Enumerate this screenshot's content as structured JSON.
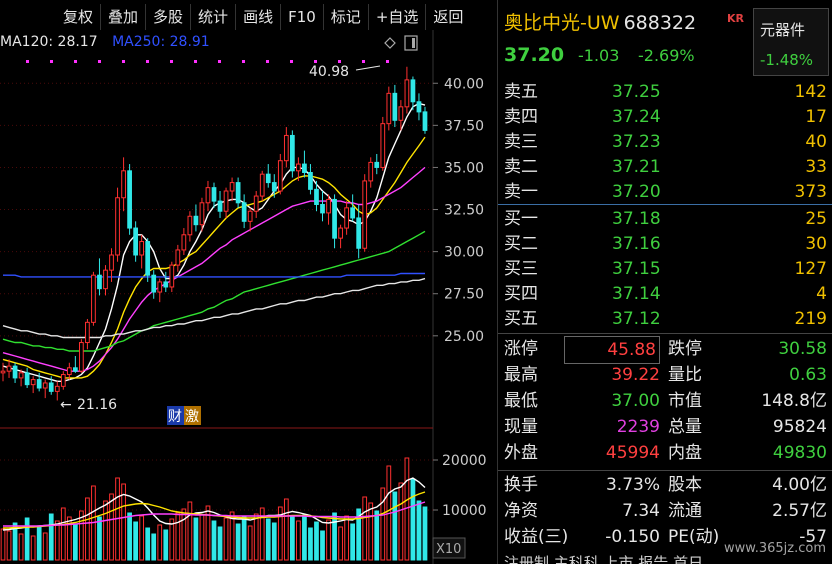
{
  "toolbar": {
    "items": [
      "复权",
      "叠加",
      "多股",
      "统计",
      "画线",
      "F10",
      "标记",
      "+自选",
      "返回"
    ]
  },
  "ma_legend": {
    "ma120": "MA120: 28.17",
    "ma250": "MA250: 28.91",
    "ma120_color": "#e6e6e6",
    "ma250_color": "#3050ff"
  },
  "chart_data": {
    "type": "candlestick",
    "y_ticks": [
      "40.00",
      "37.50",
      "35.00",
      "32.50",
      "30.00",
      "27.50",
      "25.00"
    ],
    "y_tick_values": [
      40.0,
      37.5,
      35.0,
      32.5,
      30.0,
      27.5,
      25.0
    ],
    "ylim": [
      20.0,
      41.5
    ],
    "high_annotation": "40.98",
    "low_annotation": "21.16",
    "volume_ticks": [
      "20000",
      "10000"
    ],
    "volume_tick_values": [
      20000,
      10000
    ],
    "volume_ylim": [
      0,
      24000
    ],
    "volume_unit": "X10",
    "badge_1": "财",
    "badge_2": "激",
    "candles": [
      [
        22.8,
        23.4,
        22.3,
        22.9
      ],
      [
        22.9,
        23.6,
        22.5,
        23.2
      ],
      [
        23.2,
        23.4,
        22.2,
        22.5
      ],
      [
        22.5,
        23.0,
        22.0,
        22.8
      ],
      [
        22.8,
        23.1,
        21.9,
        22.1
      ],
      [
        22.1,
        22.6,
        21.6,
        22.4
      ],
      [
        22.4,
        22.8,
        21.7,
        21.9
      ],
      [
        21.9,
        22.4,
        21.3,
        22.2
      ],
      [
        22.2,
        22.6,
        21.5,
        21.7
      ],
      [
        21.7,
        22.3,
        21.16,
        22.0
      ],
      [
        22.0,
        22.9,
        21.8,
        22.7
      ],
      [
        22.7,
        23.4,
        22.4,
        23.1
      ],
      [
        23.1,
        23.8,
        22.8,
        22.9
      ],
      [
        22.9,
        24.8,
        22.8,
        24.6
      ],
      [
        24.6,
        26.0,
        24.2,
        25.8
      ],
      [
        25.8,
        28.8,
        25.6,
        28.6
      ],
      [
        28.6,
        29.6,
        27.4,
        27.8
      ],
      [
        27.8,
        29.2,
        27.4,
        28.9
      ],
      [
        28.9,
        30.2,
        28.2,
        29.8
      ],
      [
        29.8,
        33.8,
        29.4,
        33.2
      ],
      [
        33.2,
        35.6,
        32.4,
        34.8
      ],
      [
        34.8,
        35.2,
        31.0,
        31.4
      ],
      [
        31.4,
        31.8,
        29.4,
        29.8
      ],
      [
        29.8,
        31.0,
        29.0,
        30.6
      ],
      [
        30.6,
        30.8,
        28.2,
        28.6
      ],
      [
        28.6,
        28.9,
        27.2,
        27.6
      ],
      [
        27.6,
        28.4,
        27.0,
        28.2
      ],
      [
        28.2,
        28.8,
        27.6,
        27.9
      ],
      [
        27.9,
        29.4,
        27.6,
        29.2
      ],
      [
        29.2,
        30.4,
        28.8,
        30.1
      ],
      [
        30.1,
        31.4,
        29.8,
        31.0
      ],
      [
        31.0,
        32.4,
        30.6,
        32.1
      ],
      [
        32.1,
        32.8,
        31.2,
        31.6
      ],
      [
        31.6,
        33.2,
        31.2,
        32.9
      ],
      [
        32.9,
        34.2,
        32.4,
        33.8
      ],
      [
        33.8,
        34.1,
        32.6,
        33.0
      ],
      [
        33.0,
        33.6,
        32.0,
        32.4
      ],
      [
        32.4,
        33.8,
        32.0,
        33.6
      ],
      [
        33.6,
        34.4,
        33.0,
        34.1
      ],
      [
        34.1,
        34.4,
        32.6,
        32.9
      ],
      [
        32.9,
        33.4,
        31.4,
        31.8
      ],
      [
        31.8,
        32.6,
        31.2,
        32.4
      ],
      [
        32.4,
        33.6,
        32.0,
        33.3
      ],
      [
        33.3,
        34.8,
        33.0,
        34.6
      ],
      [
        34.6,
        35.2,
        33.8,
        34.1
      ],
      [
        34.1,
        34.6,
        33.2,
        33.6
      ],
      [
        33.6,
        35.8,
        33.4,
        35.4
      ],
      [
        35.4,
        37.4,
        35.0,
        36.9
      ],
      [
        36.9,
        37.2,
        34.4,
        34.8
      ],
      [
        34.8,
        35.6,
        34.2,
        35.2
      ],
      [
        35.2,
        36.0,
        34.4,
        34.7
      ],
      [
        34.7,
        35.2,
        33.4,
        33.7
      ],
      [
        33.7,
        34.2,
        32.4,
        32.8
      ],
      [
        32.8,
        33.6,
        31.8,
        32.3
      ],
      [
        32.3,
        33.4,
        31.6,
        33.1
      ],
      [
        33.1,
        33.4,
        30.2,
        30.8
      ],
      [
        30.8,
        31.6,
        30.2,
        31.4
      ],
      [
        31.4,
        33.0,
        31.0,
        32.6
      ],
      [
        32.6,
        33.4,
        31.8,
        32.0
      ],
      [
        32.0,
        32.8,
        29.6,
        30.2
      ],
      [
        30.2,
        34.6,
        30.0,
        34.2
      ],
      [
        34.2,
        35.6,
        33.8,
        35.3
      ],
      [
        35.3,
        35.8,
        34.6,
        35.0
      ],
      [
        35.0,
        38.0,
        34.8,
        37.6
      ],
      [
        37.6,
        39.8,
        37.2,
        39.4
      ],
      [
        39.4,
        39.9,
        37.4,
        37.8
      ],
      [
        37.8,
        39.0,
        37.2,
        38.6
      ],
      [
        38.6,
        40.98,
        38.2,
        40.2
      ],
      [
        40.2,
        40.4,
        38.4,
        38.9
      ],
      [
        38.9,
        39.4,
        37.8,
        38.3
      ],
      [
        38.3,
        38.6,
        37.0,
        37.2
      ]
    ],
    "ma_lines": [
      {
        "color": "#ffffff",
        "values": [
          23.2,
          23.1,
          23.0,
          22.9,
          22.8,
          22.7,
          22.6,
          22.5,
          22.4,
          22.3,
          22.3,
          22.4,
          22.5,
          22.7,
          23.1,
          23.8,
          24.6,
          25.4,
          26.6,
          28.0,
          29.8,
          30.6,
          31.0,
          31.0,
          30.6,
          30.0,
          29.0,
          28.4,
          28.4,
          28.6,
          29.2,
          30.0,
          30.6,
          31.3,
          32.2,
          32.7,
          32.9,
          33.0,
          33.1,
          33.1,
          32.9,
          32.6,
          32.4,
          32.6,
          33.1,
          33.6,
          34.0,
          34.6,
          35.0,
          35.0,
          34.9,
          34.5,
          34.0,
          33.6,
          33.3,
          32.8,
          32.2,
          31.9,
          31.8,
          31.6,
          31.8,
          32.4,
          33.2,
          34.4,
          35.6,
          36.4,
          37.2,
          38.0,
          38.6,
          38.8,
          38.7
        ]
      },
      {
        "color": "#ffe400",
        "values": [
          23.6,
          23.5,
          23.4,
          23.3,
          23.2,
          23.0,
          22.9,
          22.8,
          22.7,
          22.6,
          22.5,
          22.5,
          22.5,
          22.5,
          22.6,
          22.9,
          23.3,
          23.9,
          24.6,
          25.4,
          26.4,
          27.2,
          27.9,
          28.4,
          28.8,
          29.0,
          29.0,
          29.0,
          29.1,
          29.3,
          29.5,
          29.8,
          30.0,
          30.4,
          30.8,
          31.2,
          31.6,
          32.0,
          32.3,
          32.6,
          32.7,
          32.8,
          32.9,
          33.0,
          33.2,
          33.4,
          33.6,
          33.9,
          34.2,
          34.4,
          34.5,
          34.5,
          34.4,
          34.3,
          34.1,
          33.8,
          33.4,
          33.1,
          32.8,
          32.4,
          32.2,
          32.3,
          32.6,
          33.1,
          33.6,
          34.1,
          34.7,
          35.3,
          35.8,
          36.3,
          36.8
        ]
      },
      {
        "color": "#ff40ff",
        "values": [
          24.0,
          23.9,
          23.8,
          23.7,
          23.6,
          23.5,
          23.4,
          23.3,
          23.2,
          23.1,
          23.0,
          22.9,
          22.9,
          22.9,
          23.0,
          23.2,
          23.5,
          23.9,
          24.3,
          24.8,
          25.4,
          26.0,
          26.5,
          27.0,
          27.4,
          27.7,
          27.9,
          28.1,
          28.3,
          28.5,
          28.7,
          28.9,
          29.1,
          29.3,
          29.6,
          29.9,
          30.2,
          30.4,
          30.7,
          30.9,
          31.1,
          31.3,
          31.5,
          31.7,
          31.9,
          32.1,
          32.3,
          32.5,
          32.7,
          32.8,
          32.9,
          33.0,
          33.0,
          33.0,
          33.0,
          33.0,
          33.0,
          32.9,
          32.9,
          32.8,
          32.8,
          32.9,
          33.0,
          33.2,
          33.4,
          33.6,
          33.8,
          34.1,
          34.4,
          34.7,
          35.0
        ]
      },
      {
        "color": "#30e030",
        "values": [
          24.8,
          24.7,
          24.6,
          24.6,
          24.5,
          24.4,
          24.4,
          24.3,
          24.3,
          24.2,
          24.2,
          24.1,
          24.1,
          24.1,
          24.1,
          24.1,
          24.2,
          24.3,
          24.4,
          24.6,
          24.7,
          24.9,
          25.1,
          25.3,
          25.4,
          25.6,
          25.7,
          25.8,
          25.9,
          26.0,
          26.1,
          26.2,
          26.3,
          26.4,
          26.6,
          26.7,
          26.9,
          27.1,
          27.2,
          27.4,
          27.6,
          27.7,
          27.8,
          27.9,
          28.0,
          28.1,
          28.2,
          28.3,
          28.4,
          28.5,
          28.6,
          28.7,
          28.8,
          28.9,
          29.0,
          29.1,
          29.2,
          29.3,
          29.4,
          29.5,
          29.6,
          29.7,
          29.8,
          29.9,
          30.0,
          30.2,
          30.4,
          30.6,
          30.8,
          31.0,
          31.2
        ]
      },
      {
        "color": "#e6e6e6",
        "values": [
          25.6,
          25.5,
          25.4,
          25.3,
          25.3,
          25.2,
          25.1,
          25.1,
          25.0,
          25.0,
          24.9,
          24.9,
          24.9,
          24.9,
          24.9,
          24.9,
          24.9,
          25.0,
          25.0,
          25.1,
          25.1,
          25.2,
          25.3,
          25.3,
          25.4,
          25.5,
          25.5,
          25.6,
          25.6,
          25.7,
          25.7,
          25.8,
          25.9,
          25.9,
          26.0,
          26.1,
          26.1,
          26.2,
          26.3,
          26.3,
          26.4,
          26.5,
          26.6,
          26.6,
          26.7,
          26.8,
          26.9,
          26.9,
          27.0,
          27.1,
          27.1,
          27.2,
          27.3,
          27.3,
          27.4,
          27.5,
          27.5,
          27.6,
          27.7,
          27.7,
          27.8,
          27.9,
          28.0,
          28.0,
          28.1,
          28.1,
          28.2,
          28.2,
          28.3,
          28.3,
          28.4
        ]
      },
      {
        "color": "#3050ff",
        "values": [
          28.6,
          28.6,
          28.6,
          28.5,
          28.5,
          28.5,
          28.5,
          28.5,
          28.5,
          28.5,
          28.5,
          28.5,
          28.5,
          28.5,
          28.5,
          28.5,
          28.5,
          28.5,
          28.5,
          28.5,
          28.5,
          28.5,
          28.5,
          28.5,
          28.5,
          28.5,
          28.5,
          28.5,
          28.5,
          28.5,
          28.5,
          28.5,
          28.5,
          28.5,
          28.5,
          28.5,
          28.5,
          28.5,
          28.5,
          28.5,
          28.5,
          28.5,
          28.5,
          28.5,
          28.5,
          28.5,
          28.5,
          28.5,
          28.5,
          28.5,
          28.5,
          28.5,
          28.5,
          28.5,
          28.5,
          28.5,
          28.5,
          28.6,
          28.6,
          28.6,
          28.6,
          28.6,
          28.6,
          28.6,
          28.6,
          28.6,
          28.7,
          28.7,
          28.7,
          28.7,
          28.7
        ]
      }
    ],
    "volumes": [
      6200,
      5800,
      7400,
      5200,
      8400,
      4800,
      6600,
      5400,
      9200,
      7800,
      10400,
      8600,
      7200,
      9800,
      12400,
      14800,
      8600,
      11800,
      13200,
      16400,
      15200,
      9400,
      7600,
      8800,
      6400,
      5200,
      7000,
      6000,
      8200,
      9400,
      10200,
      11600,
      8400,
      9000,
      10800,
      7800,
      6600,
      8400,
      9600,
      7200,
      8800,
      6800,
      9200,
      10400,
      8200,
      7400,
      10600,
      12200,
      8600,
      7800,
      9000,
      6400,
      7600,
      5800,
      8000,
      9400,
      6600,
      8800,
      7200,
      10200,
      12600,
      11400,
      9800,
      14400,
      18800,
      13600,
      15400,
      20400,
      16200,
      11800,
      10600
    ],
    "vol_ma": [
      {
        "color": "#ffffff",
        "values": [
          6000,
          6100,
          6300,
          6400,
          6600,
          6700,
          6800,
          6900,
          7000,
          7200,
          7500,
          7800,
          8100,
          8500,
          9000,
          9700,
          10400,
          11000,
          11800,
          12600,
          13100,
          12800,
          12200,
          11600,
          10400,
          9000,
          7800,
          7300,
          7200,
          7500,
          8100,
          9000,
          9400,
          9500,
          9800,
          9500,
          9000,
          8600,
          8300,
          8200,
          8200,
          8000,
          8300,
          8600,
          8900,
          8900,
          9000,
          9400,
          9700,
          9500,
          9200,
          8900,
          8200,
          7500,
          7400,
          7600,
          7800,
          8100,
          8000,
          8700,
          9600,
          10200,
          10600,
          11600,
          13400,
          14200,
          14600,
          15900,
          16400,
          15600,
          14500
        ]
      },
      {
        "color": "#ffe400",
        "values": [
          6400,
          6400,
          6500,
          6500,
          6600,
          6600,
          6700,
          6800,
          6900,
          7000,
          7100,
          7300,
          7500,
          7800,
          8100,
          8500,
          8900,
          9300,
          9800,
          10300,
          10800,
          11000,
          11200,
          11300,
          11200,
          10900,
          10600,
          10200,
          9800,
          9600,
          9400,
          9300,
          9200,
          9100,
          9000,
          8900,
          8800,
          8700,
          8600,
          8500,
          8400,
          8400,
          8400,
          8500,
          8600,
          8600,
          8700,
          8800,
          8900,
          8900,
          8900,
          8800,
          8700,
          8500,
          8400,
          8300,
          8200,
          8200,
          8200,
          8300,
          8500,
          8700,
          8900,
          9300,
          9900,
          10600,
          11200,
          12000,
          12700,
          13200,
          13600
        ]
      },
      {
        "color": "#ff40ff",
        "values": [
          6800,
          6800,
          6800,
          6800,
          6800,
          6800,
          6800,
          6900,
          6900,
          7000,
          7000,
          7100,
          7200,
          7300,
          7400,
          7500,
          7700,
          7900,
          8100,
          8300,
          8500,
          8700,
          8900,
          9000,
          9100,
          9200,
          9200,
          9200,
          9200,
          9100,
          9100,
          9100,
          9000,
          9000,
          9000,
          8900,
          8900,
          8900,
          8800,
          8800,
          8800,
          8800,
          8800,
          8800,
          8800,
          8800,
          8800,
          8800,
          8800,
          8800,
          8800,
          8700,
          8700,
          8700,
          8700,
          8700,
          8600,
          8600,
          8600,
          8600,
          8700,
          8800,
          8900,
          9000,
          9300,
          9600,
          10000,
          10400,
          10800,
          11200,
          11600
        ]
      }
    ]
  },
  "quote": {
    "name": "奥比中光-UW",
    "code": "688322",
    "kr_badge": "KR",
    "price": "37.20",
    "change": "-1.03",
    "change_pct": "-2.69%",
    "sector_name": "元器件",
    "sector_pct": "-1.48%"
  },
  "order_book": {
    "asks": [
      {
        "label": "卖五",
        "price": "37.25",
        "vol": "142"
      },
      {
        "label": "卖四",
        "price": "37.24",
        "vol": "17"
      },
      {
        "label": "卖三",
        "price": "37.23",
        "vol": "40"
      },
      {
        "label": "卖二",
        "price": "37.21",
        "vol": "33"
      },
      {
        "label": "卖一",
        "price": "37.20",
        "vol": "373"
      }
    ],
    "bids": [
      {
        "label": "买一",
        "price": "37.18",
        "vol": "25"
      },
      {
        "label": "买二",
        "price": "37.16",
        "vol": "30"
      },
      {
        "label": "买三",
        "price": "37.15",
        "vol": "127"
      },
      {
        "label": "买四",
        "price": "37.14",
        "vol": "4"
      },
      {
        "label": "买五",
        "price": "37.12",
        "vol": "219"
      }
    ]
  },
  "stats": {
    "limit_up_label": "涨停",
    "limit_up": "45.88",
    "limit_down_label": "跌停",
    "limit_down": "30.58",
    "high_label": "最高",
    "high": "39.22",
    "vol_ratio_label": "量比",
    "vol_ratio": "0.63",
    "low_label": "最低",
    "low": "37.00",
    "mcap_label": "市值",
    "mcap": "148.8亿",
    "cur_vol_label": "现量",
    "cur_vol": "2239",
    "total_vol_label": "总量",
    "total_vol": "95824",
    "outer_label": "外盘",
    "outer": "45994",
    "inner_label": "内盘",
    "inner": "49830",
    "turnover_label": "换手",
    "turnover": "3.73%",
    "equity_label": "股本",
    "equity": "4.00亿",
    "nav_label": "净资",
    "nav": "7.34",
    "float_label": "流通",
    "float": "2.57亿",
    "eps_label": "收益(三)",
    "eps": "-0.150",
    "pe_label": "PE(动)",
    "pe": "-57"
  },
  "footer": {
    "cutoff_text": "注册制 主科科 上市 报告 首日",
    "watermark": "www.365jz.com"
  }
}
